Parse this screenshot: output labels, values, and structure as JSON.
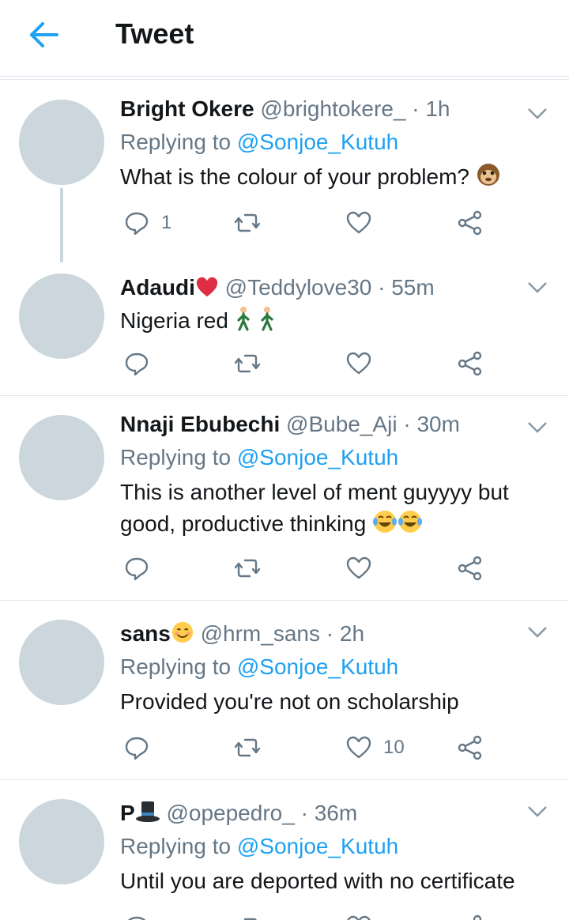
{
  "header": {
    "title": "Tweet"
  },
  "tweets": [
    {
      "name": "Bright Okere",
      "handle": "@brightokere_",
      "time": "1h",
      "replying_prefix": "Replying to",
      "replying_to": "@Sonjoe_Kutuh",
      "text": "What is the colour of your problem?",
      "emoji": "monkey-face",
      "reply_count": "1",
      "like_count": ""
    },
    {
      "name": "Adaudi",
      "name_emoji": "red-heart",
      "handle": "@Teddylove30",
      "time": "55m",
      "text": "Nigeria red",
      "emoji": "person-walking x2",
      "reply_count": "",
      "like_count": ""
    },
    {
      "name": "Nnaji Ebubechi",
      "handle": "@Bube_Aji",
      "time": "30m",
      "replying_prefix": "Replying to",
      "replying_to": "@Sonjoe_Kutuh",
      "text_line1": "This is another level of ment guyyyy but",
      "text_line2": "good, productive thinking",
      "emoji": "tears-of-joy x2",
      "reply_count": "",
      "like_count": ""
    },
    {
      "name": "sans",
      "name_emoji": "smiling-face",
      "handle": "@hrm_sans",
      "time": "2h",
      "replying_prefix": "Replying to",
      "replying_to": "@Sonjoe_Kutuh",
      "text": "Provided you're not on scholarship",
      "reply_count": "",
      "like_count": "10"
    },
    {
      "name": "P",
      "name_emoji": "top-hat",
      "handle": "@opepedro_",
      "time": "36m",
      "replying_prefix": "Replying to",
      "replying_to": "@Sonjoe_Kutuh",
      "text": "Until you are deported with no certificate"
    }
  ],
  "colors": {
    "accent": "#1da1f2",
    "muted": "#657786",
    "avatar": "#ccd6dd",
    "heart": "#e0245e"
  }
}
